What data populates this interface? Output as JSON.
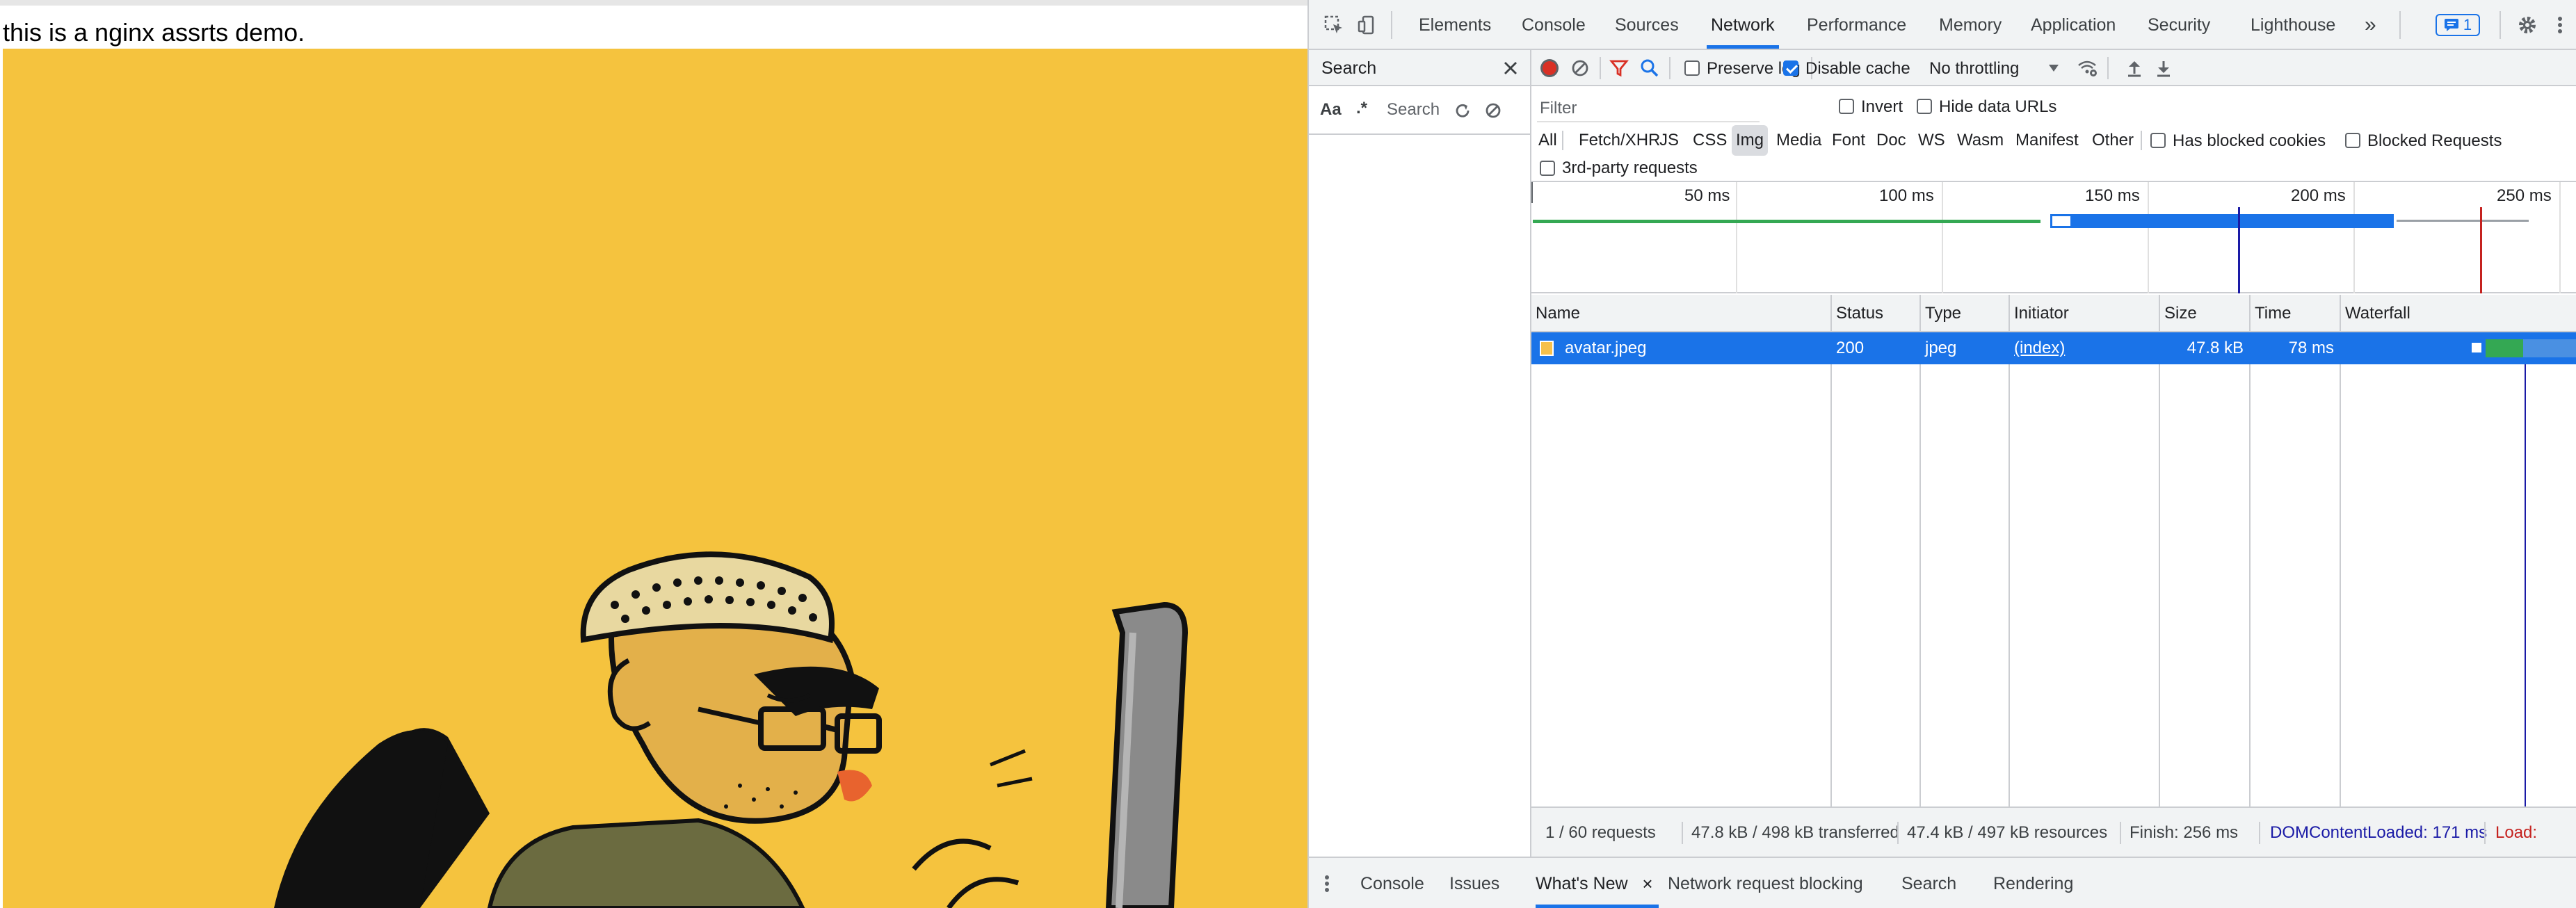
{
  "page": {
    "text": "this is a nginx assrts demo."
  },
  "devtools": {
    "tabs": [
      "Elements",
      "Console",
      "Sources",
      "Network",
      "Performance",
      "Memory",
      "Application",
      "Security",
      "Lighthouse"
    ],
    "active_tab": "Network",
    "more_tabs_glyph": "»",
    "issues_badge_count": "1",
    "search_panel": {
      "title": "Search",
      "match_case": "Aa",
      "regex": ".*",
      "placeholder": "Search"
    },
    "toolbar": {
      "preserve_log": "Preserve log",
      "disable_cache": "Disable cache",
      "throttling": "No throttling"
    },
    "filter": {
      "placeholder": "Filter",
      "invert": "Invert",
      "hide_data_urls": "Hide data URLs",
      "types": [
        "All",
        "Fetch/XHR",
        "JS",
        "CSS",
        "Img",
        "Media",
        "Font",
        "Doc",
        "WS",
        "Wasm",
        "Manifest",
        "Other"
      ],
      "active_type": "Img",
      "has_blocked_cookies": "Has blocked cookies",
      "blocked_requests": "Blocked Requests",
      "third_party": "3rd-party requests"
    },
    "overview": {
      "ticks": [
        "50 ms",
        "100 ms",
        "150 ms",
        "200 ms",
        "250 ms"
      ]
    },
    "table": {
      "columns": [
        "Name",
        "Status",
        "Type",
        "Initiator",
        "Size",
        "Time",
        "Waterfall"
      ],
      "rows": [
        {
          "name": "avatar.jpeg",
          "status": "200",
          "type": "jpeg",
          "initiator": "(index)",
          "size": "47.8 kB",
          "time": "78 ms"
        }
      ]
    },
    "status": {
      "requests": "1 / 60 requests",
      "transferred": "47.8 kB / 498 kB transferred",
      "resources": "47.4 kB / 497 kB resources",
      "finish": "Finish: 256 ms",
      "dom_content_loaded": "DOMContentLoaded: 171 ms",
      "load": "Load:"
    },
    "drawer_tabs": [
      "Console",
      "Issues",
      "What's New",
      "Network request blocking",
      "Search",
      "Rendering"
    ],
    "drawer_active": "What's New",
    "drawer_close": "×"
  },
  "colors": {
    "accent": "#1a73e8",
    "record": "#d93025",
    "page_image_bg": "#f5c33e",
    "dcl": "#1a1aa6",
    "load": "#c5221f"
  }
}
